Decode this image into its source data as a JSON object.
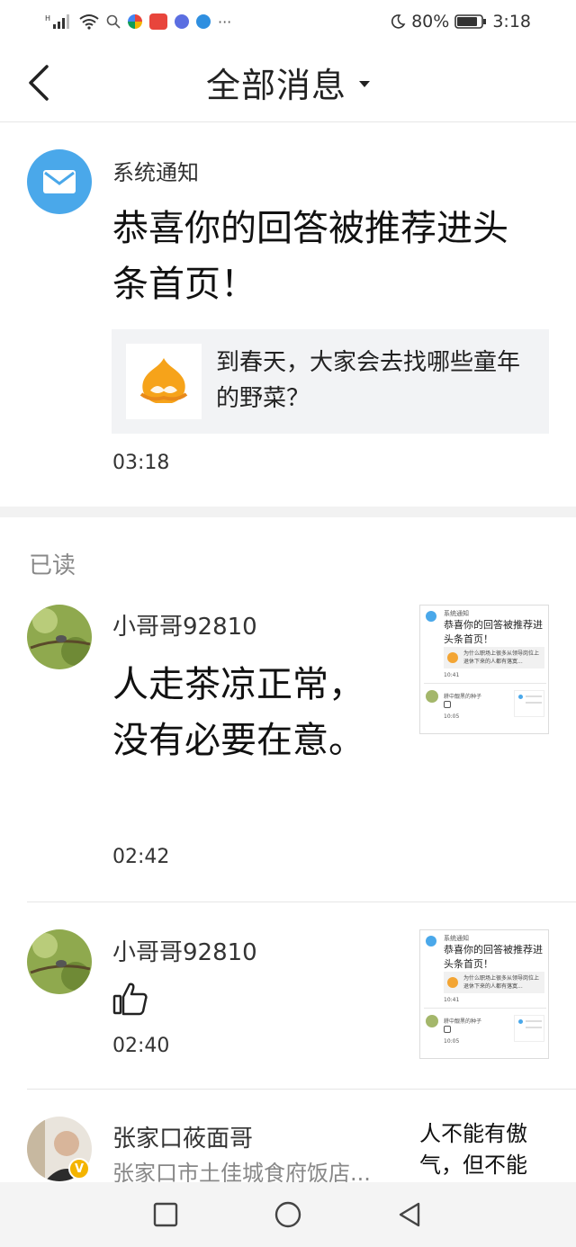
{
  "status_bar": {
    "battery": "80%",
    "time": "3:18"
  },
  "header": {
    "title": "全部消息"
  },
  "system_notice": {
    "sender": "系统通知",
    "message": "恭喜你的回答被推荐进头条首页！",
    "card_text": "到春天，大家会去找哪些童年的野菜？",
    "time": "03:18"
  },
  "read_label": "已读",
  "messages": [
    {
      "user": "小哥哥92810",
      "text": "人走茶凉正常，没有必要在意。",
      "time": "02:42"
    },
    {
      "user": "小哥哥92810",
      "text": "",
      "time": "02:40"
    },
    {
      "user": "张家口莜面哥",
      "subtitle": "张家口市土佳城食府饭店...",
      "snippet": "人不能有傲气，但不能"
    }
  ],
  "mini_preview": {
    "sender": "系统通知",
    "message": "恭喜你的回答被推荐进头条首页！",
    "card": "为什么职场上很多从领导岗位上退休下来的人都有落寞...",
    "time": "10:41",
    "user": "耕中靓黑的种子",
    "time2": "10:05"
  },
  "colors": {
    "accent_blue": "#4aa8ea",
    "badge_yellow": "#f4b400"
  }
}
